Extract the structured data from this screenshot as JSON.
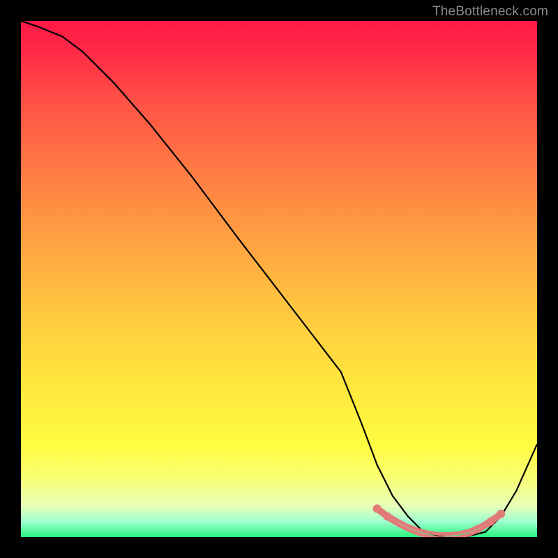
{
  "watermark": "TheBottleneck.com",
  "chart_data": {
    "type": "line",
    "title": "",
    "xlabel": "",
    "ylabel": "",
    "xlim": [
      0,
      100
    ],
    "ylim": [
      0,
      100
    ],
    "grid": false,
    "legend": false,
    "series": [
      {
        "name": "bottleneck-curve",
        "color": "#000000",
        "x": [
          0,
          3,
          8,
          12,
          18,
          25,
          33,
          42,
          52,
          62,
          66,
          69,
          72,
          75,
          78,
          82,
          86,
          90,
          93,
          96,
          100
        ],
        "y": [
          100,
          99,
          97,
          94,
          88,
          80,
          70,
          58,
          45,
          32,
          22,
          14,
          8,
          4,
          1,
          0,
          0,
          1,
          4,
          9,
          18
        ]
      },
      {
        "name": "highlight-range",
        "color": "#e27a78",
        "type": "scatter",
        "x": [
          69,
          71,
          73,
          75,
          77,
          79,
          81,
          83,
          85,
          87,
          89,
          91,
          93
        ],
        "y": [
          5.5,
          4.0,
          2.8,
          1.8,
          1.0,
          0.5,
          0.2,
          0.2,
          0.4,
          0.9,
          1.8,
          3.0,
          4.5
        ]
      }
    ]
  }
}
